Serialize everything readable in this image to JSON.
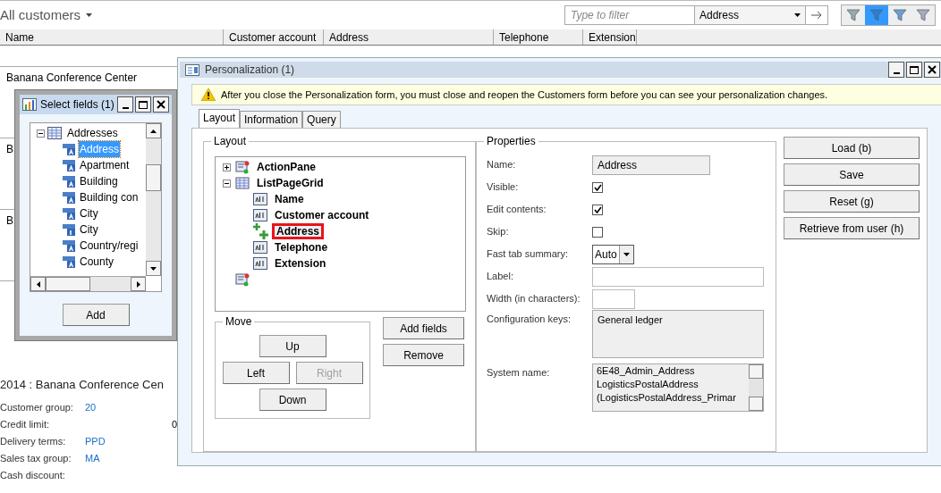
{
  "page": {
    "title": "All customers",
    "filter": {
      "placeholder": "Type to filter",
      "field": "Address"
    },
    "filter_buttons": [
      {
        "selected": false
      },
      {
        "selected": true
      },
      {
        "selected": false
      },
      {
        "selected": false
      }
    ],
    "grid": {
      "columns": [
        "Name",
        "Customer account",
        "Address",
        "Telephone",
        "Extension"
      ],
      "rows": [
        {
          "name": "Banana Conference Center"
        },
        {
          "name": "B"
        },
        {
          "name": "B"
        }
      ]
    },
    "details": {
      "title": "2014 : Banana Conference Cen",
      "fields": [
        {
          "label": "Customer group:",
          "value": "20",
          "link": true
        },
        {
          "label": "Credit limit:",
          "value": "0",
          "link": false
        },
        {
          "label": "Delivery terms:",
          "value": "PPD",
          "link": true
        },
        {
          "label": "Sales tax group:",
          "value": "MA",
          "link": true
        },
        {
          "label": "Cash discount:"
        }
      ]
    }
  },
  "personalization": {
    "title": "Personalization (1)",
    "warning": "After you close the Personalization form, you must close and reopen the Customers form before you can see your personalization changes.",
    "tabs": [
      {
        "label": "Layout",
        "selected": true
      },
      {
        "label": "Information",
        "selected": false
      },
      {
        "label": "Query",
        "selected": false
      }
    ],
    "layout": {
      "title": "Layout",
      "tree": [
        {
          "label": "ActionPane",
          "kind": "pane",
          "expanded": false,
          "highlighted": false
        },
        {
          "label": "ListPageGrid",
          "kind": "grid",
          "expanded": true,
          "highlighted": false,
          "children": [
            {
              "label": "Name",
              "kind": "field",
              "highlighted": false
            },
            {
              "label": "Customer account",
              "kind": "field",
              "highlighted": false
            },
            {
              "label": "Address",
              "kind": "new",
              "highlighted": true
            },
            {
              "label": "Telephone",
              "kind": "field",
              "highlighted": false
            },
            {
              "label": "Extension",
              "kind": "field",
              "highlighted": false
            }
          ]
        },
        {
          "kind": "pane"
        }
      ],
      "move": {
        "title": "Move",
        "buttons": [
          {
            "label": "Up",
            "disabled": false
          },
          {
            "label": "Left",
            "disabled": false
          },
          {
            "label": "Right",
            "disabled": true
          },
          {
            "label": "Down",
            "disabled": false
          }
        ]
      },
      "buttons": [
        "Add fields",
        "Remove"
      ]
    },
    "properties": {
      "title": "Properties",
      "rows": [
        {
          "label": "Name:",
          "kind": "readonly",
          "value": "Address"
        },
        {
          "label": "Visible:",
          "kind": "checkbox",
          "checked": true
        },
        {
          "label": "Edit contents:",
          "kind": "checkbox",
          "checked": true
        },
        {
          "label": "Skip:",
          "kind": "checkbox",
          "checked": false
        },
        {
          "label": "Fast tab summary:",
          "kind": "select",
          "value": "Auto"
        },
        {
          "label": "Label:",
          "kind": "input"
        },
        {
          "label": "Width (in characters):",
          "kind": "short-input"
        },
        {
          "label": "Configuration keys:",
          "kind": "area",
          "value": "General ledger"
        },
        {
          "label": "System name:",
          "kind": "list",
          "lines": [
            "6E48_Admin_Address",
            "LogisticsPostalAddress",
            "(LogisticsPostalAddress_Primar"
          ]
        }
      ]
    },
    "side_buttons": [
      "Load (b)",
      "Save",
      "Reset (g)",
      "Retrieve from user (h)"
    ]
  },
  "select_fields": {
    "title": "Select fields (1)",
    "tree": {
      "label": "Addresses",
      "expanded": true,
      "children": [
        {
          "label": "Address",
          "kind": "text",
          "selected": true
        },
        {
          "label": "Apartment",
          "kind": "text",
          "selected": false
        },
        {
          "label": "Building",
          "kind": "text",
          "selected": false
        },
        {
          "label": "Building con",
          "kind": "text",
          "selected": false
        },
        {
          "label": "City",
          "kind": "text",
          "selected": false
        },
        {
          "label": "City",
          "kind": "number",
          "selected": false
        },
        {
          "label": "Country/regi",
          "kind": "text",
          "selected": false
        },
        {
          "label": "County",
          "kind": "text",
          "selected": false
        }
      ]
    },
    "button": "Add"
  }
}
